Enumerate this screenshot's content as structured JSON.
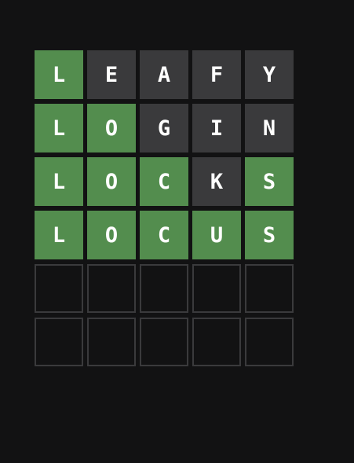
{
  "colors": {
    "background": "#121213",
    "correct": "#538d4e",
    "present": "#b59f3b",
    "absent": "#3a3a3c",
    "empty_border": "#3a3a3c",
    "text": "#ffffff"
  },
  "board": {
    "rows": [
      {
        "tiles": [
          {
            "letter": "L",
            "state": "correct"
          },
          {
            "letter": "E",
            "state": "absent"
          },
          {
            "letter": "A",
            "state": "absent"
          },
          {
            "letter": "F",
            "state": "absent"
          },
          {
            "letter": "Y",
            "state": "absent"
          }
        ]
      },
      {
        "tiles": [
          {
            "letter": "L",
            "state": "correct"
          },
          {
            "letter": "O",
            "state": "correct"
          },
          {
            "letter": "G",
            "state": "absent"
          },
          {
            "letter": "I",
            "state": "absent"
          },
          {
            "letter": "N",
            "state": "absent"
          }
        ]
      },
      {
        "tiles": [
          {
            "letter": "L",
            "state": "correct"
          },
          {
            "letter": "O",
            "state": "correct"
          },
          {
            "letter": "C",
            "state": "correct"
          },
          {
            "letter": "K",
            "state": "absent"
          },
          {
            "letter": "S",
            "state": "correct"
          }
        ]
      },
      {
        "tiles": [
          {
            "letter": "L",
            "state": "correct"
          },
          {
            "letter": "O",
            "state": "correct"
          },
          {
            "letter": "C",
            "state": "correct"
          },
          {
            "letter": "U",
            "state": "correct"
          },
          {
            "letter": "S",
            "state": "correct"
          }
        ]
      },
      {
        "tiles": [
          {
            "letter": "",
            "state": "empty"
          },
          {
            "letter": "",
            "state": "empty"
          },
          {
            "letter": "",
            "state": "empty"
          },
          {
            "letter": "",
            "state": "empty"
          },
          {
            "letter": "",
            "state": "empty"
          }
        ]
      },
      {
        "tiles": [
          {
            "letter": "",
            "state": "empty"
          },
          {
            "letter": "",
            "state": "empty"
          },
          {
            "letter": "",
            "state": "empty"
          },
          {
            "letter": "",
            "state": "empty"
          },
          {
            "letter": "",
            "state": "empty"
          }
        ]
      }
    ]
  }
}
